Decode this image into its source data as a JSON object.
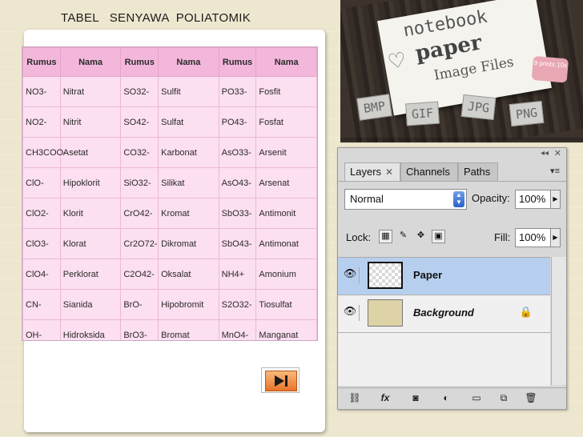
{
  "page": {
    "title": "TABEL   SENYAWA  POLIATOMIK"
  },
  "table": {
    "headers": [
      "Rumus",
      "Nama",
      "Rumus",
      "Nama",
      "Rumus",
      "Nama"
    ],
    "rows": [
      [
        "NO3-",
        "Nitrat",
        "SO32-",
        "Sulfit",
        "PO33-",
        "Fosfit"
      ],
      [
        "NO2-",
        "Nitrit",
        "SO42-",
        "Sulfat",
        "PO43-",
        "Fosfat"
      ],
      [
        "CH3COO-",
        "Asetat",
        "CO32-",
        "Karbonat",
        "AsO33-",
        "Arsenit"
      ],
      [
        "ClO-",
        "Hipoklorit",
        "SiO32-",
        "Silikat",
        "AsO43-",
        "Arsenat"
      ],
      [
        "ClO2-",
        "Klorit",
        "CrO42-",
        "Kromat",
        "SbO33-",
        "Antimonit"
      ],
      [
        "ClO3-",
        "Klorat",
        "Cr2O72-",
        "Dikromat",
        "SbO43-",
        "Antimonat"
      ],
      [
        "ClO4-",
        "Perklorat",
        "C2O42-",
        "Oksalat",
        "NH4+",
        "Amonium"
      ],
      [
        "CN-",
        "Sianida",
        "BrO-",
        "Hipobromit",
        "S2O32-",
        "Tiosulfat"
      ],
      [
        "OH-",
        "Hidroksida",
        "BrO3-",
        "Bromat",
        "MnO4-",
        "Manganat"
      ]
    ]
  },
  "photo": {
    "title1": "notebook",
    "title2": "paper",
    "subtitle": "Image Files",
    "tag": "9 prints 10x",
    "files": [
      "BMP",
      "GIF",
      "JPG",
      "PNG"
    ]
  },
  "layers_panel": {
    "tabs": [
      "Layers",
      "Channels",
      "Paths"
    ],
    "blend_mode": "Normal",
    "opacity_label": "Opacity:",
    "opacity_value": "100%",
    "lock_label": "Lock:",
    "fill_label": "Fill:",
    "fill_value": "100%",
    "layers": [
      {
        "name": "Paper",
        "selected": true
      },
      {
        "name": "Background",
        "locked": true
      }
    ],
    "footer_icons": [
      "link-icon",
      "fx-icon",
      "mask-icon",
      "adjustment-icon",
      "folder-icon",
      "new-layer-icon",
      "trash-icon"
    ]
  },
  "colors": {
    "table_header": "#f3b7db",
    "table_cell": "#fcdff0",
    "selected_layer": "#b7cfee",
    "next_button": "#e9742a"
  }
}
